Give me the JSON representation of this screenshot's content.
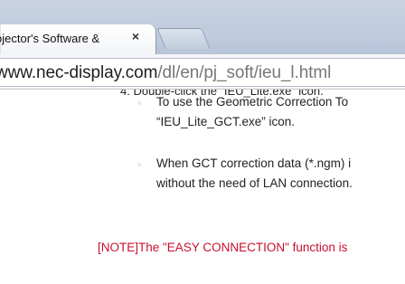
{
  "browser": {
    "tab": {
      "title": "ojector's Software &",
      "close_glyph": "×"
    },
    "address_bar": {
      "host": "www.nec-display.com",
      "path": "/dl/en/pj_soft/ieu_l.html"
    }
  },
  "page": {
    "step": "4.  Double-click the “IEU_Lite.exe” icon.",
    "bullets": [
      {
        "marker": "◦",
        "line1": "To use the Geometric Correction To",
        "line2": "“IEU_Lite_GCT.exe” icon."
      },
      {
        "marker": "◦",
        "line1": "When GCT correction data (*.ngm) i",
        "line2": "without the need of LAN connection."
      }
    ],
    "note": "[NOTE]The \"EASY CONNECTION\" function is"
  }
}
